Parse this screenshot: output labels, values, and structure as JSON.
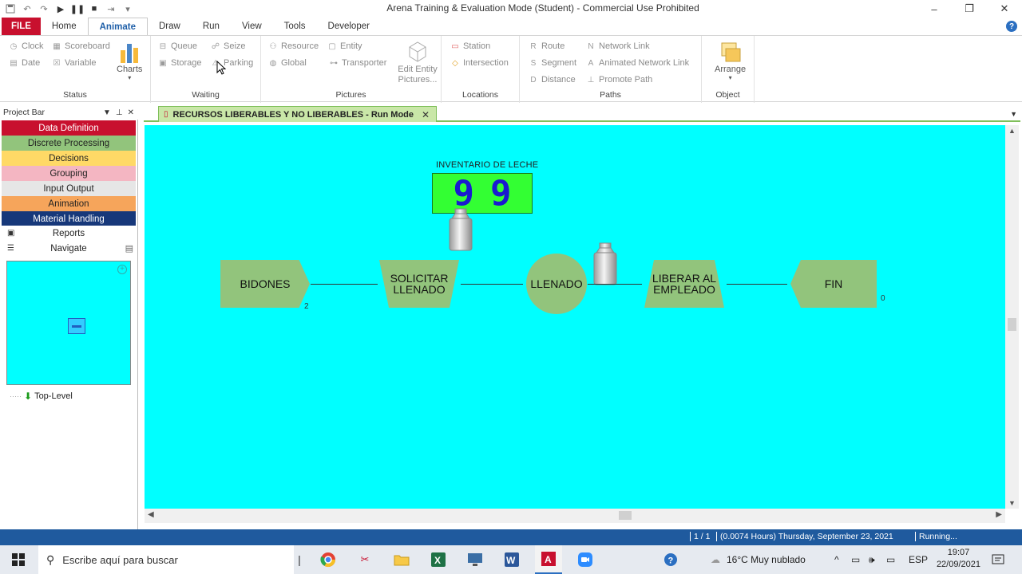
{
  "window": {
    "title": "Arena Training & Evaluation Mode (Student) - Commercial Use Prohibited",
    "minimize": "–",
    "maximize": "❐",
    "close": "✕"
  },
  "tabs": [
    "FILE",
    "Home",
    "Animate",
    "Draw",
    "Run",
    "View",
    "Tools",
    "Developer"
  ],
  "active_tab": "Animate",
  "ribbon": {
    "status": {
      "label": "Status",
      "clock": "Clock",
      "scoreboard": "Scoreboard",
      "date": "Date",
      "variable": "Variable",
      "charts": "Charts"
    },
    "waiting": {
      "label": "Waiting",
      "queue": "Queue",
      "seize": "Seize",
      "storage": "Storage",
      "parking": "Parking"
    },
    "pictures": {
      "label": "Pictures",
      "resource": "Resource",
      "entity": "Entity",
      "global": "Global",
      "transporter": "Transporter",
      "edit_entity_pictures": "Edit Entity Pictures..."
    },
    "locations": {
      "label": "Locations",
      "station": "Station",
      "intersection": "Intersection"
    },
    "paths": {
      "label": "Paths",
      "route": "Route",
      "network_link": "Network Link",
      "segment": "Segment",
      "animated_network_link": "Animated Network Link",
      "distance": "Distance",
      "promote_path": "Promote Path"
    },
    "object": {
      "label": "Object",
      "arrange": "Arrange"
    }
  },
  "project_bar": {
    "title": "Project Bar",
    "panels": [
      {
        "label": "Data Definition",
        "color": "#c8102e",
        "text_color": "#ffffff"
      },
      {
        "label": "Discrete Processing",
        "color": "#92c47c",
        "text_color": "#222222"
      },
      {
        "label": "Decisions",
        "color": "#ffd966",
        "text_color": "#222222"
      },
      {
        "label": "Grouping",
        "color": "#f4b6c2",
        "text_color": "#222222"
      },
      {
        "label": "Input Output",
        "color": "#e6e6e6",
        "text_color": "#222222"
      },
      {
        "label": "Animation",
        "color": "#f6a55b",
        "text_color": "#222222"
      },
      {
        "label": "Material Handling",
        "color": "#17387a",
        "text_color": "#ffffff"
      }
    ],
    "reports": "Reports",
    "navigate": "Navigate",
    "tree_item": "Top-Level"
  },
  "document_tab": {
    "title": "RECURSOS LIBERABLES Y NO LIBERABLES - Run Mode",
    "close": "✕"
  },
  "canvas": {
    "background": "#00ffff",
    "variable_title": "INVENTARIO DE LECHE",
    "variable_digits": [
      "9",
      "9"
    ],
    "modules": {
      "create": "BIDONES",
      "seize": "SOLICITAR LLENADO",
      "process": "LLENADO",
      "release": "LIBERAR AL EMPLEADO",
      "dispose": "FIN"
    },
    "create_counter": "2",
    "dispose_counter": "0"
  },
  "status_bar": {
    "page": "1 / 1",
    "time": "(0.0074 Hours) Thursday, September 23, 2021",
    "state": "Running..."
  },
  "taskbar": {
    "search_placeholder": "Escribe aquí para buscar",
    "weather": "16°C  Muy nublado",
    "language": "ESP",
    "time": "19:07",
    "date": "22/09/2021"
  }
}
